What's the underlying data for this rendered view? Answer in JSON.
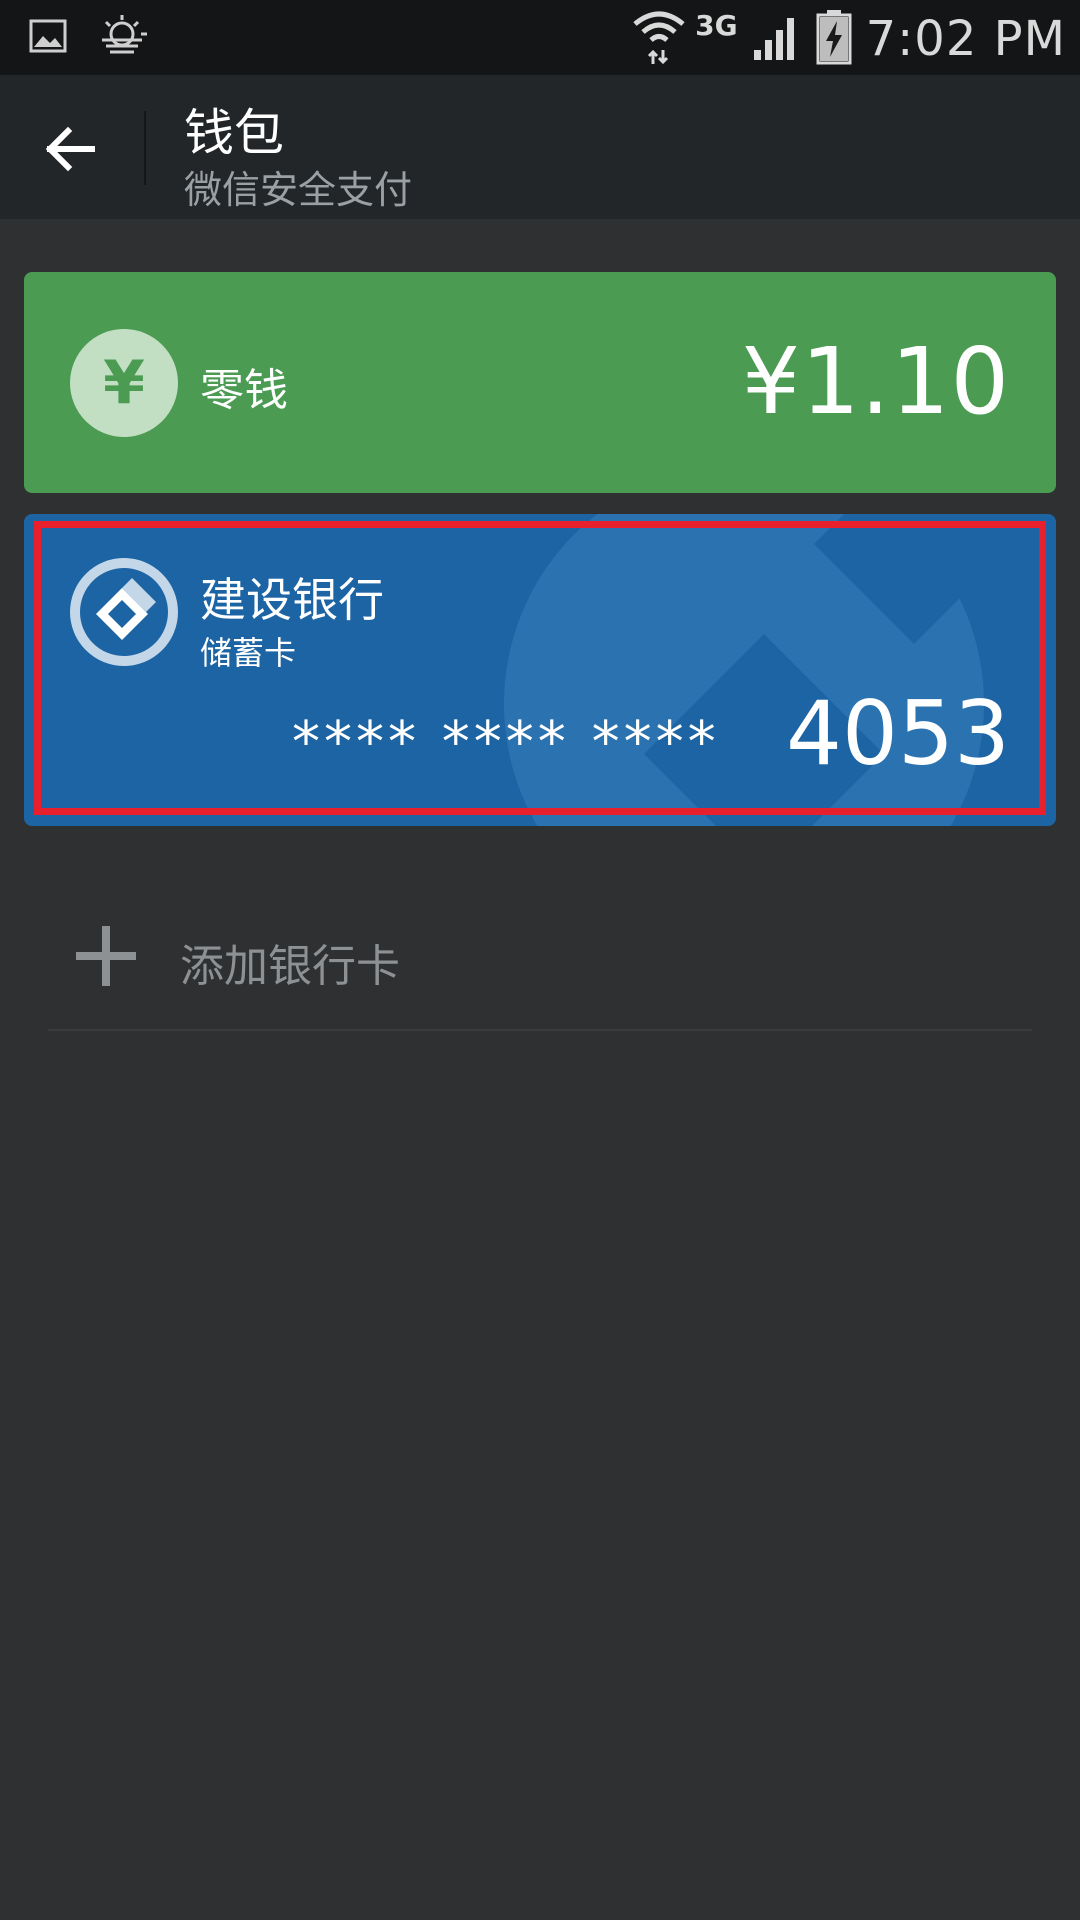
{
  "status_bar": {
    "network": "3G",
    "time": "7:02 PM"
  },
  "header": {
    "title": "钱包",
    "subtitle": "微信安全支付"
  },
  "change_card": {
    "icon_symbol": "¥",
    "label": "零钱",
    "amount": "¥1.10",
    "color": "#4b9b53"
  },
  "bank_card": {
    "bank_name": "建设银行",
    "card_type": "储蓄卡",
    "masked_number": "**** **** ****",
    "last_digits": "4053",
    "color": "#1c64a4",
    "highlight_color": "#e8202e"
  },
  "add_card": {
    "label": "添加银行卡"
  }
}
